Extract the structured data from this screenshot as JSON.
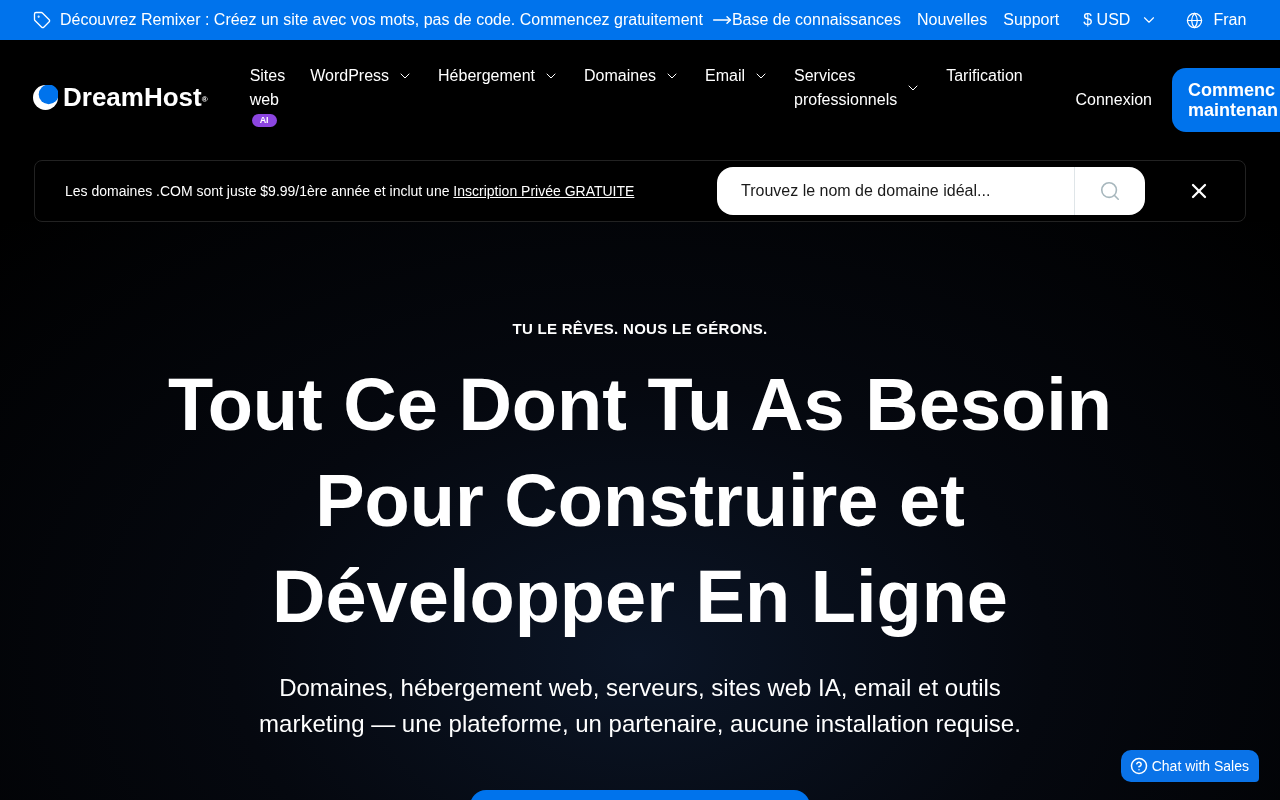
{
  "announcement_bar": {
    "promo": "Découvrez Remixer : Créez un site avec vos mots, pas de code. Commencez gratuitement",
    "links": [
      "Base de connaissances",
      "Nouvelles",
      "Support"
    ],
    "currency": "$ USD",
    "language": "Fran"
  },
  "nav": {
    "logo": "DreamHost$^{®}$",
    "items": [
      {
        "label": "Sites web",
        "dropdown": false,
        "badge": "AI"
      },
      {
        "label": "WordPress",
        "dropdown": true
      },
      {
        "label": "Hébergement",
        "dropdown": true
      },
      {
        "label": "Domaines",
        "dropdown": true
      },
      {
        "label": "Email",
        "dropdown": true
      },
      {
        "label": "Services professionnels",
        "dropdown": true
      },
      {
        "label": "Tarification",
        "dropdown": false
      }
    ],
    "login": "Connexion",
    "cta": "Commenc maintenan"
  },
  "promo_banner": {
    "text": "Les domaines .COM sont juste $9.99/1ère année et inclut une",
    "link": "Inscription Privée GRATUITE",
    "search": {
      "placeholder": "Trouvez le nom de domaine idéal..."
    }
  },
  "hero": {
    "eyebrow": "TU LE RÊVES. NOUS LE GÉRONS.",
    "title": "Tout Ce Dont Tu As Besoin Pour Construire et Développer En Ligne",
    "subtitle": "Domaines, hébergement web, serveurs, sites web IA, email et outils marketing — une plateforme, un partenaire, aucune installation requise."
  },
  "chat_button": {
    "label": "Chat with Sales"
  }
}
